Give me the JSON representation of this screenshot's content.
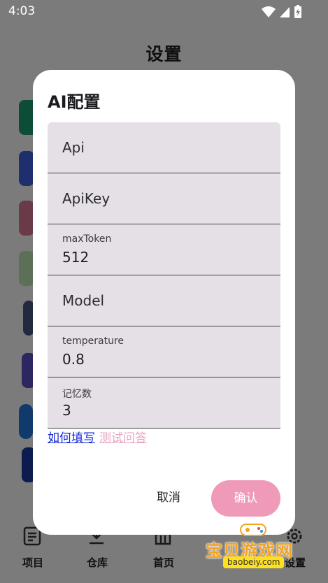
{
  "status_bar": {
    "time": "4:03"
  },
  "background": {
    "page_title": "设置",
    "nav": [
      {
        "label": "项目",
        "icon": "document-icon"
      },
      {
        "label": "仓库",
        "icon": "download-icon"
      },
      {
        "label": "首页",
        "icon": "home-icon"
      },
      {
        "label": "设置",
        "icon": "gear-icon"
      }
    ],
    "side_icons": [
      "chatgpt-icon",
      "code-icon",
      "tool-icon",
      "image-icon",
      "phone-icon",
      "hourglass-icon",
      "plugin-icon",
      "hashtag-icon"
    ]
  },
  "dialog": {
    "title": "AI配置",
    "fields": [
      {
        "name": "api",
        "placeholder": "Api",
        "label": "",
        "value": ""
      },
      {
        "name": "apikey",
        "placeholder": "ApiKey",
        "label": "",
        "value": ""
      },
      {
        "name": "maxtoken",
        "placeholder": "",
        "label": "maxToken",
        "value": "512"
      },
      {
        "name": "model",
        "placeholder": "Model",
        "label": "",
        "value": ""
      },
      {
        "name": "temperature",
        "placeholder": "",
        "label": "temperature",
        "value": "0.8"
      },
      {
        "name": "memory",
        "placeholder": "",
        "label": "记忆数",
        "value": "3"
      }
    ],
    "help_link": "如何填写",
    "test_link": "测试问答",
    "cancel_label": "取消",
    "confirm_label": "确认"
  },
  "watermark": {
    "text": "宝贝游戏网",
    "url": "baobeiy.com"
  },
  "colors": {
    "accent": "#ef9ab8",
    "field_bg": "#e5e0e6",
    "link": "#1428d8"
  }
}
